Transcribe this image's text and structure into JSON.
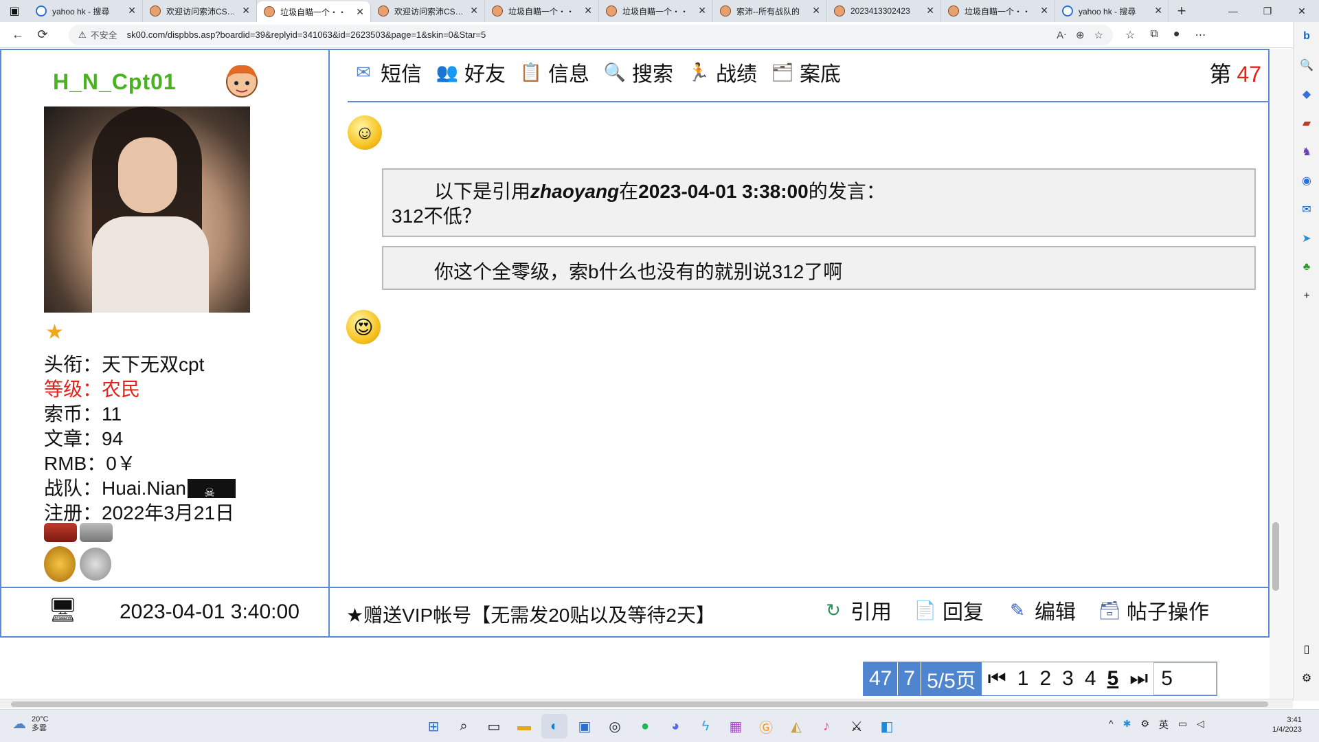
{
  "browser": {
    "tabs": [
      {
        "title": "yahoo hk - 搜尋",
        "icon": "search"
      },
      {
        "title": "欢迎访问索沛CS1.6",
        "icon": "face"
      },
      {
        "title": "垃圾自瞄一个・・",
        "icon": "face",
        "active": true
      },
      {
        "title": "欢迎访问索沛CS1.6",
        "icon": "face"
      },
      {
        "title": "垃圾自瞄一个・・",
        "icon": "face"
      },
      {
        "title": "垃圾自瞄一个・・",
        "icon": "face"
      },
      {
        "title": "索沛--所有战队的",
        "icon": "face"
      },
      {
        "title": "2023413302423",
        "icon": "face"
      },
      {
        "title": "垃圾自瞄一个・・",
        "icon": "face"
      },
      {
        "title": "yahoo hk - 搜尋",
        "icon": "search"
      }
    ],
    "security_label": "不安全",
    "url": "sk00.com/dispbbs.asp?boardid=39&replyid=341063&id=2623503&page=1&skin=0&Star=5"
  },
  "profile": {
    "username": "H_N_Cpt01",
    "fields": [
      {
        "label": "头衔：",
        "value": "天下无双cpt",
        "color": "#111111"
      },
      {
        "label": "等级：",
        "value": "农民",
        "color": "#e2231a"
      },
      {
        "label": "索币：",
        "value": "11",
        "color": "#111111"
      },
      {
        "label": "文章：",
        "value": "94",
        "color": "#111111"
      },
      {
        "label": "RMB：",
        "value": "0￥",
        "color": "#111111"
      },
      {
        "label": "战队：",
        "value": "Huai.Nian",
        "color": "#111111"
      },
      {
        "label": "注册：",
        "value": "2022年3月21日",
        "color": "#111111"
      }
    ]
  },
  "post_toolbar": {
    "items": [
      {
        "label": "短信",
        "icon": "message-icon"
      },
      {
        "label": "好友",
        "icon": "friends-icon"
      },
      {
        "label": "信息",
        "icon": "info-icon"
      },
      {
        "label": "搜索",
        "icon": "search-icon"
      },
      {
        "label": "战绩",
        "icon": "stats-icon"
      },
      {
        "label": "案底",
        "icon": "record-icon"
      }
    ],
    "floor_prefix": "第",
    "floor_number": "47"
  },
  "post": {
    "quote_intro_pre": "以下是引用",
    "quote_author": "zhaoyang",
    "quote_mid": "在",
    "quote_time": "2023-04-01 3:38:00",
    "quote_post": "的发言：",
    "quote_text": "312不低？",
    "reply_text": "你这个全零级，索b什么也没有的就别说312了啊"
  },
  "footer": {
    "datetime": "2023-04-01 3:40:00",
    "notice": "★赠送VIP帐号【无需发20贴以及等待2天】",
    "actions": [
      {
        "label": "引用",
        "icon": "quote-icon"
      },
      {
        "label": "回复",
        "icon": "reply-icon"
      },
      {
        "label": "编辑",
        "icon": "edit-icon"
      },
      {
        "label": "帖子操作",
        "icon": "post-manage-icon"
      }
    ]
  },
  "pager": {
    "total_posts": "47",
    "per_page": "7",
    "page_info": "5/5页",
    "first_icon": "⏮",
    "pages": [
      "1",
      "2",
      "3",
      "4",
      "5"
    ],
    "current_page": "5",
    "last_icon": "⏭",
    "goto_value": "5"
  },
  "taskbar": {
    "temperature": "20°C",
    "weather": "多雲",
    "ime": "英",
    "clock_time": "3:41",
    "clock_date": "1/4/2023"
  }
}
